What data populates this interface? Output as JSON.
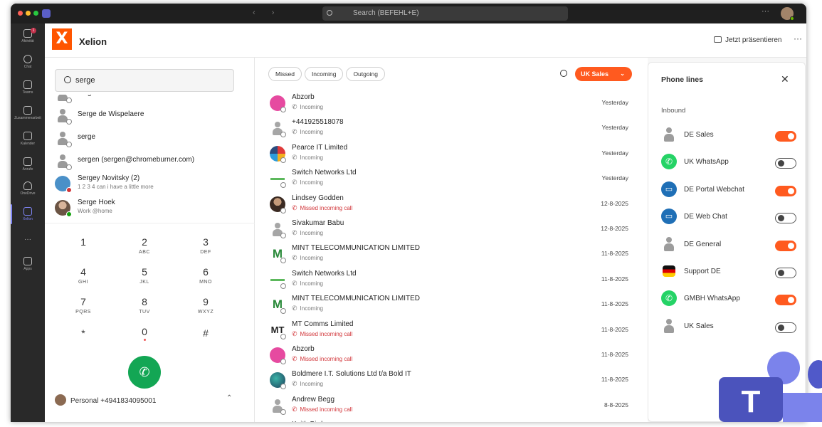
{
  "titlebar": {
    "search_placeholder": "Search (BEFEHL+E)",
    "more": "···"
  },
  "rail": {
    "items": [
      {
        "label": "Aktivität",
        "badge": "1"
      },
      {
        "label": "Chat"
      },
      {
        "label": "Teams"
      },
      {
        "label": "Zusammenarbeit"
      },
      {
        "label": "Kalender"
      },
      {
        "label": "Anrufe"
      },
      {
        "label": "OneDrive"
      },
      {
        "label": "Xelion"
      },
      {
        "label": "···"
      },
      {
        "label": "Apps"
      }
    ]
  },
  "header": {
    "logo": "X",
    "app_name": "Xelion",
    "present_label": "Jetzt präsentieren",
    "more": "···"
  },
  "search": {
    "value": "serge"
  },
  "contacts": [
    {
      "name": "serge",
      "sub": ""
    },
    {
      "name": "Serge de Wispelaere",
      "sub": ""
    },
    {
      "name": "serge",
      "sub": ""
    },
    {
      "name": "sergen (sergen@chromeburner.com)",
      "sub": ""
    },
    {
      "name": "Sergey Novitsky (2)",
      "sub": "1 2 3 4 can i have a little more"
    },
    {
      "name": "Serge Hoek",
      "sub": "Work @home"
    }
  ],
  "keypad": [
    {
      "digit": "1",
      "letters": ""
    },
    {
      "digit": "2",
      "letters": "ABC"
    },
    {
      "digit": "3",
      "letters": "DEF"
    },
    {
      "digit": "4",
      "letters": "GHI"
    },
    {
      "digit": "5",
      "letters": "JKL"
    },
    {
      "digit": "6",
      "letters": "MNO"
    },
    {
      "digit": "7",
      "letters": "PQRS"
    },
    {
      "digit": "8",
      "letters": "TUV"
    },
    {
      "digit": "9",
      "letters": "WXYZ"
    },
    {
      "digit": "*",
      "letters": ""
    },
    {
      "digit": "0",
      "letters": ""
    },
    {
      "digit": "#",
      "letters": ""
    }
  ],
  "personal": {
    "label": "Personal +4941834095001",
    "chevron": "⌃"
  },
  "filters": {
    "missed": "Missed",
    "incoming": "Incoming",
    "outgoing": "Outgoing"
  },
  "group": {
    "label": "UK Sales",
    "chevron": "⌄"
  },
  "calls": [
    {
      "name": "Abzorb",
      "dir": "Incoming",
      "date": "Yesterday",
      "missed": false
    },
    {
      "name": "+441925518078",
      "dir": "Incoming",
      "date": "Yesterday",
      "missed": false
    },
    {
      "name": "Pearce IT Limited",
      "dir": "Incoming",
      "date": "Yesterday",
      "missed": false
    },
    {
      "name": "Switch Networks Ltd",
      "dir": "Incoming",
      "date": "Yesterday",
      "missed": false
    },
    {
      "name": "Lindsey Godden",
      "dir": "Missed incoming call",
      "date": "12-8-2025",
      "missed": true
    },
    {
      "name": "Sivakumar Babu",
      "dir": "Incoming",
      "date": "12-8-2025",
      "missed": false
    },
    {
      "name": "MINT TELECOMMUNICATION LIMITED",
      "dir": "Incoming",
      "date": "11-8-2025",
      "missed": false
    },
    {
      "name": "Switch Networks Ltd",
      "dir": "Incoming",
      "date": "11-8-2025",
      "missed": false
    },
    {
      "name": "MINT TELECOMMUNICATION LIMITED",
      "dir": "Incoming",
      "date": "11-8-2025",
      "missed": false
    },
    {
      "name": "MT Comms Limited",
      "dir": "Missed incoming call",
      "date": "11-8-2025",
      "missed": true
    },
    {
      "name": "Abzorb",
      "dir": "Missed incoming call",
      "date": "11-8-2025",
      "missed": true
    },
    {
      "name": "Boldmere I.T. Solutions Ltd t/a Bold IT",
      "dir": "Incoming",
      "date": "11-8-2025",
      "missed": false
    },
    {
      "name": "Andrew Begg",
      "dir": "Missed incoming call",
      "date": "8-8-2025",
      "missed": true
    },
    {
      "name": "Keith Bird",
      "dir": "",
      "date": "",
      "missed": false
    }
  ],
  "phone_lines": {
    "title": "Phone lines",
    "close": "✕",
    "section": "Inbound",
    "lines": [
      {
        "name": "DE Sales",
        "icon": "person-icon",
        "on": true
      },
      {
        "name": "UK WhatsApp",
        "icon": "whatsapp-icon",
        "on": false
      },
      {
        "name": "DE Portal Webchat",
        "icon": "webchat-icon",
        "on": true
      },
      {
        "name": "DE Web Chat",
        "icon": "webchat-icon",
        "on": false
      },
      {
        "name": "DE General",
        "icon": "person-icon",
        "on": true
      },
      {
        "name": "Support DE",
        "icon": "german-flag-icon",
        "on": false
      },
      {
        "name": "GMBH WhatsApp",
        "icon": "whatsapp-icon",
        "on": true
      },
      {
        "name": "UK Sales",
        "icon": "person-icon",
        "on": false
      }
    ]
  },
  "colors": {
    "accent": "#ff5a1f",
    "call": "#13a654",
    "missed": "#d13438",
    "teams": "#5b5fc7"
  }
}
